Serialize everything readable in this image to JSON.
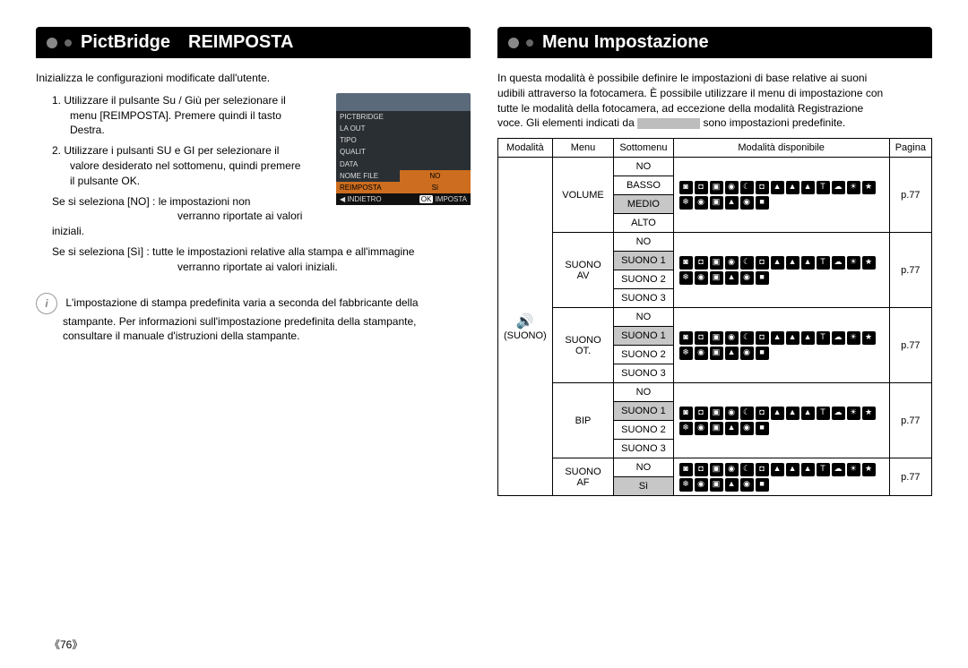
{
  "left": {
    "header": "PictBridge REIMPOSTA",
    "intro": "Inizializza le configurazioni modificate dall'utente.",
    "step1a": "1. Utilizzare il pulsante Su / Giù per selezionare il",
    "step1b": "menu [REIMPOSTA]. Premere quindi il tasto",
    "step1c": "Destra.",
    "step2a": "2. Utilizzare i pulsanti SU e GI per selezionare il",
    "step2b": "valore desiderato nel sottomenu, quindi premere",
    "step2c": "il pulsante OK.",
    "selNoA": "Se si seleziona [NO]  : le impostazioni non",
    "selNoB": "verranno riportate ai valori iniziali.",
    "selSiA": "Se si seleziona [Sì]   : tutte le impostazioni relative alla stampa e all'immagine",
    "selSiB": "verranno riportate ai valori iniziali.",
    "note1": "L'impostazione di stampa predefinita varia a seconda del fabbricante della",
    "note2": "stampante. Per informazioni sull'impostazione predefinita della stampante,",
    "note3": "consultare il manuale d'istruzioni della stampante.",
    "osd": {
      "title": "PICTBRIDGE",
      "items": [
        "LA OUT",
        "TIPO",
        "QUALIT",
        "DATA",
        "NOME FILE"
      ],
      "reimposta": "REIMPOSTA",
      "no": "NO",
      "si": "Sì",
      "backArrow": "◀",
      "back": "INDIETRO",
      "ok": "OK",
      "imposta": "IMPOSTA"
    }
  },
  "right": {
    "header": "Menu Impostazione",
    "p1": "In questa modalità è possibile definire le impostazioni di base relative ai suoni",
    "p2": "udibili attraverso la fotocamera. È possibile utilizzare il menu di impostazione con",
    "p3": "tutte le modalità della fotocamera, ad eccezione della modalità Registrazione",
    "p4a": "voce. Gli elementi indicati da",
    "p4b": "sono impostazioni predefinite.",
    "th": {
      "mode": "Modalità",
      "menu": "Menu",
      "sub": "Sottomenu",
      "avail": "Modalità disponibile",
      "page": "Pagina"
    },
    "modeIcon": "🔊",
    "modeLabel": "(SUONO)",
    "page": "p.77",
    "menus": {
      "volume": {
        "label": "VOLUME",
        "opts": [
          "NO",
          "BASSO",
          "MEDIO",
          "ALTO"
        ],
        "default": 2
      },
      "suonoav": {
        "label": "SUONO AV",
        "opts": [
          "NO",
          "SUONO 1",
          "SUONO 2",
          "SUONO 3"
        ],
        "default": 1
      },
      "suonoot": {
        "label": "SUONO OT.",
        "opts": [
          "NO",
          "SUONO 1",
          "SUONO 2",
          "SUONO 3"
        ],
        "default": 1
      },
      "bip": {
        "label": "BIP",
        "opts": [
          "NO",
          "SUONO 1",
          "SUONO 2",
          "SUONO 3"
        ],
        "default": 1
      },
      "suonoaf": {
        "label": "SUONO AF",
        "opts": [
          "NO",
          "Sì"
        ],
        "default": 1
      }
    }
  },
  "pagenum": "《76》"
}
